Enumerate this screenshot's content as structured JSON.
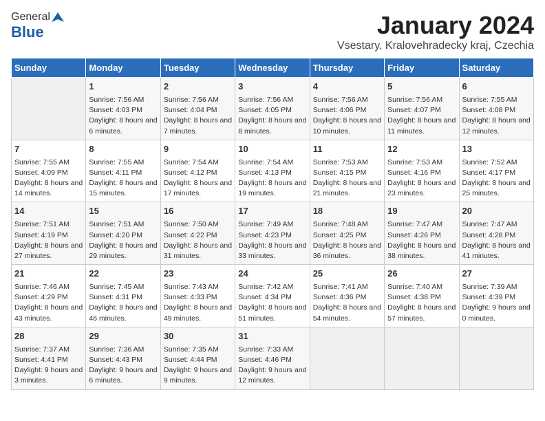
{
  "logo": {
    "general": "General",
    "blue": "Blue"
  },
  "title": "January 2024",
  "location": "Vsestary, Kralovehradecky kraj, Czechia",
  "days_of_week": [
    "Sunday",
    "Monday",
    "Tuesday",
    "Wednesday",
    "Thursday",
    "Friday",
    "Saturday"
  ],
  "weeks": [
    [
      {
        "day": "",
        "sunrise": "",
        "sunset": "",
        "daylight": ""
      },
      {
        "day": "1",
        "sunrise": "Sunrise: 7:56 AM",
        "sunset": "Sunset: 4:03 PM",
        "daylight": "Daylight: 8 hours and 6 minutes."
      },
      {
        "day": "2",
        "sunrise": "Sunrise: 7:56 AM",
        "sunset": "Sunset: 4:04 PM",
        "daylight": "Daylight: 8 hours and 7 minutes."
      },
      {
        "day": "3",
        "sunrise": "Sunrise: 7:56 AM",
        "sunset": "Sunset: 4:05 PM",
        "daylight": "Daylight: 8 hours and 8 minutes."
      },
      {
        "day": "4",
        "sunrise": "Sunrise: 7:56 AM",
        "sunset": "Sunset: 4:06 PM",
        "daylight": "Daylight: 8 hours and 10 minutes."
      },
      {
        "day": "5",
        "sunrise": "Sunrise: 7:56 AM",
        "sunset": "Sunset: 4:07 PM",
        "daylight": "Daylight: 8 hours and 11 minutes."
      },
      {
        "day": "6",
        "sunrise": "Sunrise: 7:55 AM",
        "sunset": "Sunset: 4:08 PM",
        "daylight": "Daylight: 8 hours and 12 minutes."
      }
    ],
    [
      {
        "day": "7",
        "sunrise": "Sunrise: 7:55 AM",
        "sunset": "Sunset: 4:09 PM",
        "daylight": "Daylight: 8 hours and 14 minutes."
      },
      {
        "day": "8",
        "sunrise": "Sunrise: 7:55 AM",
        "sunset": "Sunset: 4:11 PM",
        "daylight": "Daylight: 8 hours and 15 minutes."
      },
      {
        "day": "9",
        "sunrise": "Sunrise: 7:54 AM",
        "sunset": "Sunset: 4:12 PM",
        "daylight": "Daylight: 8 hours and 17 minutes."
      },
      {
        "day": "10",
        "sunrise": "Sunrise: 7:54 AM",
        "sunset": "Sunset: 4:13 PM",
        "daylight": "Daylight: 8 hours and 19 minutes."
      },
      {
        "day": "11",
        "sunrise": "Sunrise: 7:53 AM",
        "sunset": "Sunset: 4:15 PM",
        "daylight": "Daylight: 8 hours and 21 minutes."
      },
      {
        "day": "12",
        "sunrise": "Sunrise: 7:53 AM",
        "sunset": "Sunset: 4:16 PM",
        "daylight": "Daylight: 8 hours and 23 minutes."
      },
      {
        "day": "13",
        "sunrise": "Sunrise: 7:52 AM",
        "sunset": "Sunset: 4:17 PM",
        "daylight": "Daylight: 8 hours and 25 minutes."
      }
    ],
    [
      {
        "day": "14",
        "sunrise": "Sunrise: 7:51 AM",
        "sunset": "Sunset: 4:19 PM",
        "daylight": "Daylight: 8 hours and 27 minutes."
      },
      {
        "day": "15",
        "sunrise": "Sunrise: 7:51 AM",
        "sunset": "Sunset: 4:20 PM",
        "daylight": "Daylight: 8 hours and 29 minutes."
      },
      {
        "day": "16",
        "sunrise": "Sunrise: 7:50 AM",
        "sunset": "Sunset: 4:22 PM",
        "daylight": "Daylight: 8 hours and 31 minutes."
      },
      {
        "day": "17",
        "sunrise": "Sunrise: 7:49 AM",
        "sunset": "Sunset: 4:23 PM",
        "daylight": "Daylight: 8 hours and 33 minutes."
      },
      {
        "day": "18",
        "sunrise": "Sunrise: 7:48 AM",
        "sunset": "Sunset: 4:25 PM",
        "daylight": "Daylight: 8 hours and 36 minutes."
      },
      {
        "day": "19",
        "sunrise": "Sunrise: 7:47 AM",
        "sunset": "Sunset: 4:26 PM",
        "daylight": "Daylight: 8 hours and 38 minutes."
      },
      {
        "day": "20",
        "sunrise": "Sunrise: 7:47 AM",
        "sunset": "Sunset: 4:28 PM",
        "daylight": "Daylight: 8 hours and 41 minutes."
      }
    ],
    [
      {
        "day": "21",
        "sunrise": "Sunrise: 7:46 AM",
        "sunset": "Sunset: 4:29 PM",
        "daylight": "Daylight: 8 hours and 43 minutes."
      },
      {
        "day": "22",
        "sunrise": "Sunrise: 7:45 AM",
        "sunset": "Sunset: 4:31 PM",
        "daylight": "Daylight: 8 hours and 46 minutes."
      },
      {
        "day": "23",
        "sunrise": "Sunrise: 7:43 AM",
        "sunset": "Sunset: 4:33 PM",
        "daylight": "Daylight: 8 hours and 49 minutes."
      },
      {
        "day": "24",
        "sunrise": "Sunrise: 7:42 AM",
        "sunset": "Sunset: 4:34 PM",
        "daylight": "Daylight: 8 hours and 51 minutes."
      },
      {
        "day": "25",
        "sunrise": "Sunrise: 7:41 AM",
        "sunset": "Sunset: 4:36 PM",
        "daylight": "Daylight: 8 hours and 54 minutes."
      },
      {
        "day": "26",
        "sunrise": "Sunrise: 7:40 AM",
        "sunset": "Sunset: 4:38 PM",
        "daylight": "Daylight: 8 hours and 57 minutes."
      },
      {
        "day": "27",
        "sunrise": "Sunrise: 7:39 AM",
        "sunset": "Sunset: 4:39 PM",
        "daylight": "Daylight: 9 hours and 0 minutes."
      }
    ],
    [
      {
        "day": "28",
        "sunrise": "Sunrise: 7:37 AM",
        "sunset": "Sunset: 4:41 PM",
        "daylight": "Daylight: 9 hours and 3 minutes."
      },
      {
        "day": "29",
        "sunrise": "Sunrise: 7:36 AM",
        "sunset": "Sunset: 4:43 PM",
        "daylight": "Daylight: 9 hours and 6 minutes."
      },
      {
        "day": "30",
        "sunrise": "Sunrise: 7:35 AM",
        "sunset": "Sunset: 4:44 PM",
        "daylight": "Daylight: 9 hours and 9 minutes."
      },
      {
        "day": "31",
        "sunrise": "Sunrise: 7:33 AM",
        "sunset": "Sunset: 4:46 PM",
        "daylight": "Daylight: 9 hours and 12 minutes."
      },
      {
        "day": "",
        "sunrise": "",
        "sunset": "",
        "daylight": ""
      },
      {
        "day": "",
        "sunrise": "",
        "sunset": "",
        "daylight": ""
      },
      {
        "day": "",
        "sunrise": "",
        "sunset": "",
        "daylight": ""
      }
    ]
  ]
}
